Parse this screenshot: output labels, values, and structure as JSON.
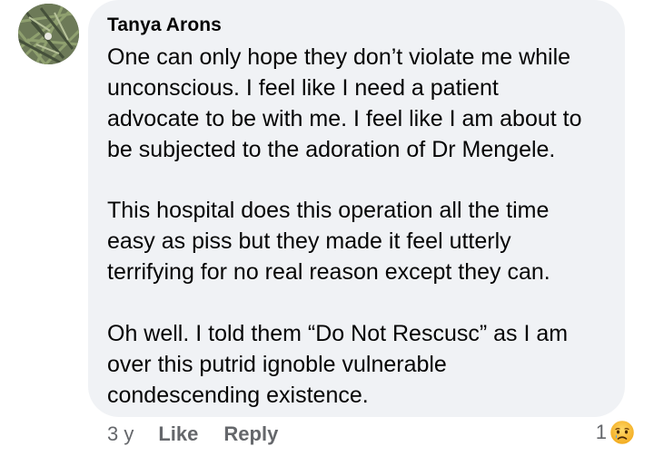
{
  "comment": {
    "author": "Tanya Arons",
    "paragraphs": [
      [
        "One can only hope they don’t violate me while",
        "unconscious.  I feel like I need a patient",
        "advocate to be with me.  I feel like I am about to",
        "be subjected to the adoration of Dr Mengele."
      ],
      [
        "This hospital does this operation all the time",
        "easy as piss but  they made it feel utterly",
        "terrifying for no real reason except they can."
      ],
      [
        "Oh well.  I told them “Do Not Rescusc” as I am",
        "over this putrid ignoble vulnerable",
        "condescending existence."
      ]
    ]
  },
  "actions": {
    "time": "3 y",
    "like_label": "Like",
    "reply_label": "Reply"
  },
  "reactions": {
    "count": "1",
    "icon": "sad-reaction-icon"
  },
  "colors": {
    "bubble": "#f0f2f5",
    "text": "#050505",
    "meta": "#65676b",
    "reaction": "#f7b125"
  }
}
